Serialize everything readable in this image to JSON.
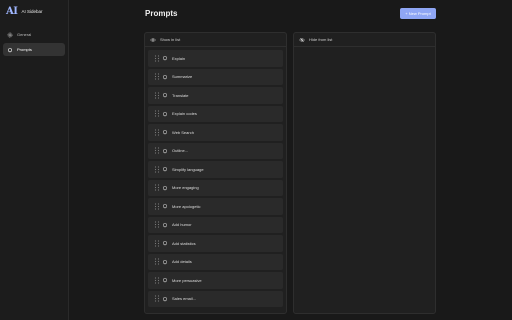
{
  "app": {
    "logo_text": "AI",
    "name": "AI Sidebar"
  },
  "nav": [
    {
      "label": "General",
      "icon": "gear-icon",
      "active": false
    },
    {
      "label": "Prompts",
      "icon": "bell-icon",
      "active": true
    }
  ],
  "page": {
    "title": "Prompts",
    "new_button_label": "+ New Prompt"
  },
  "panels": {
    "shown": {
      "header": "Show in list",
      "icon": "eye-icon"
    },
    "hidden": {
      "header": "Hide from list",
      "icon": "eye-off-icon"
    }
  },
  "prompts": [
    "Explain",
    "Summarize",
    "Translate",
    "Explain codes",
    "Web Search",
    "Outline...",
    "Simplify language",
    "More engaging",
    "More apologetic",
    "Add humor",
    "Add statistics",
    "Add details",
    "More persuasive",
    "Sales email..."
  ],
  "colors": {
    "accent": "#8fa6f5",
    "background": "#191919",
    "item": "#2a2a2a"
  }
}
